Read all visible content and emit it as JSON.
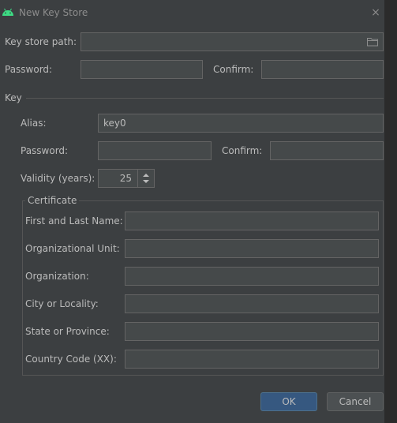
{
  "window": {
    "title": "New Key Store",
    "close_glyph": "×"
  },
  "keystore": {
    "path_label": "Key store path:",
    "path_value": "",
    "folder_icon": "folder-icon",
    "password_label": "Password:",
    "confirm_label": "Confirm:"
  },
  "key": {
    "section_label": "Key",
    "alias_label": "Alias:",
    "alias_value": "key0",
    "password_label": "Password:",
    "confirm_label": "Confirm:",
    "validity_label": "Validity (years):",
    "validity_value": "25"
  },
  "certificate": {
    "group_label": "Certificate",
    "fields": [
      {
        "label": "First and Last Name:",
        "value": ""
      },
      {
        "label": "Organizational Unit:",
        "value": ""
      },
      {
        "label": "Organization:",
        "value": ""
      },
      {
        "label": "City or Locality:",
        "value": ""
      },
      {
        "label": "State or Province:",
        "value": ""
      },
      {
        "label": "Country Code (XX):",
        "value": ""
      }
    ]
  },
  "buttons": {
    "ok": "OK",
    "cancel": "Cancel"
  },
  "colors": {
    "dialog_bg": "#3c3f41",
    "field_bg": "#45494a",
    "ok_bg": "#365880",
    "android_green": "#3ddc84"
  }
}
